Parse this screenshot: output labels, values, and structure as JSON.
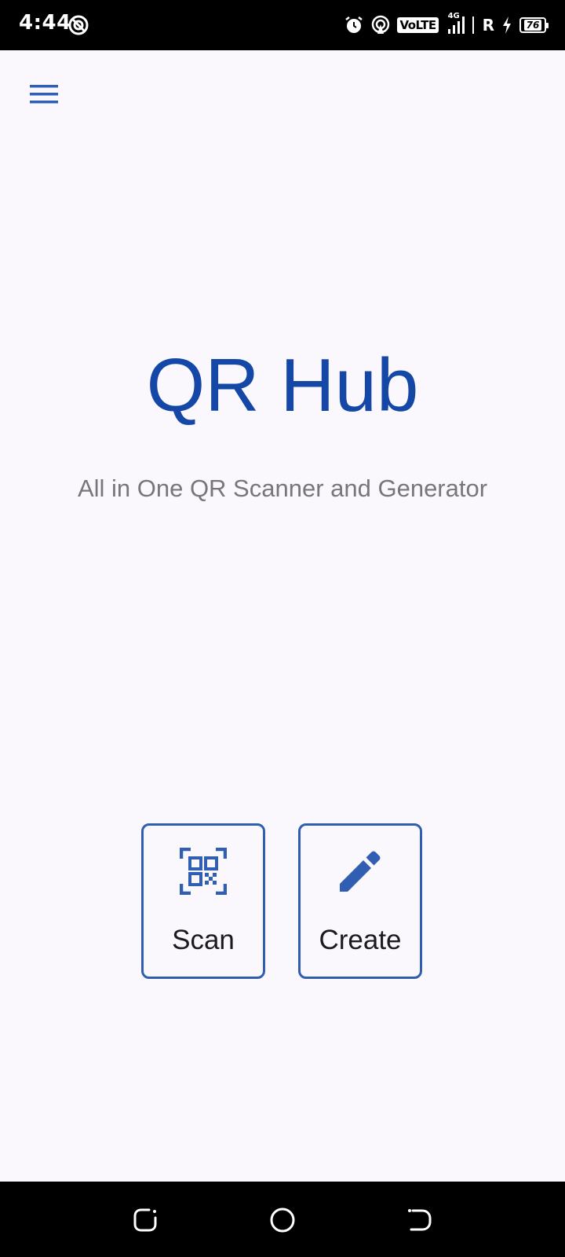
{
  "status_bar": {
    "time": "4:44",
    "volte": "VoLTE",
    "network": "4G",
    "roaming": "R",
    "battery": "76"
  },
  "app": {
    "title": "QR Hub",
    "subtitle": "All in One QR Scanner and Generator"
  },
  "actions": {
    "scan_label": "Scan",
    "create_label": "Create"
  },
  "icons": {
    "menu": "menu-icon",
    "scan": "qr-code-scanner-icon",
    "create": "pencil-icon",
    "dnd": "do-not-disturb-icon",
    "alarm": "alarm-icon",
    "hotspot": "hotspot-icon",
    "signal": "signal-icon",
    "charging": "charging-icon",
    "recents": "recents-icon",
    "home": "home-icon",
    "back": "back-icon"
  },
  "colors": {
    "accent": "#1547a7",
    "button_border": "#2f5eb3",
    "background": "#fbf8fd",
    "subtitle": "#77767b"
  }
}
